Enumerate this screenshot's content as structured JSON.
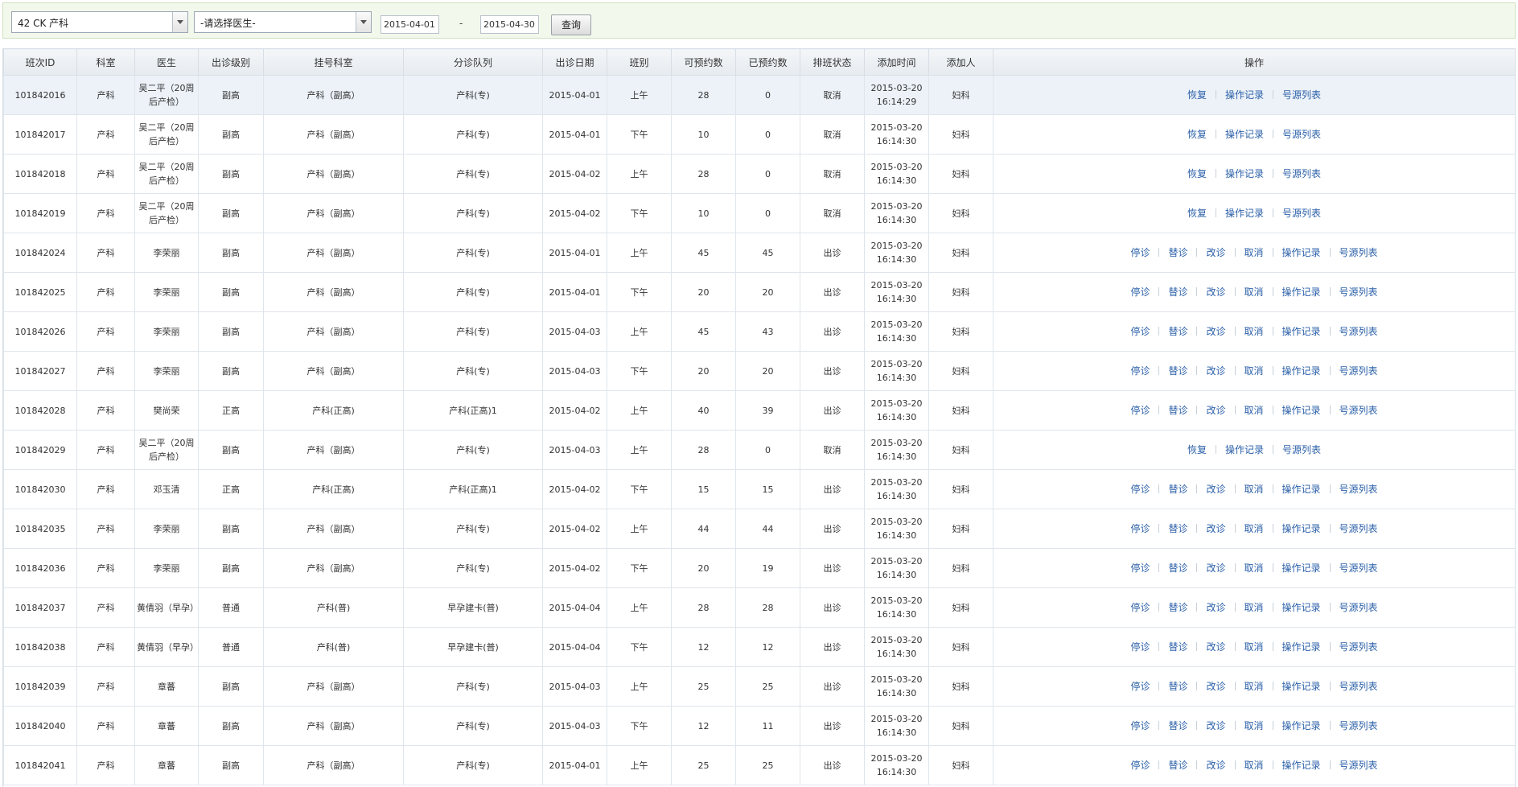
{
  "filters": {
    "department_select": "42 CK 产科",
    "doctor_select": "-请选择医生-",
    "date_from": "2015-04-01",
    "date_separator": "-",
    "date_to": "2015-04-30",
    "query_button": "查询"
  },
  "table": {
    "headers": [
      "班次ID",
      "科室",
      "医生",
      "出诊级别",
      "挂号科室",
      "分诊队列",
      "出诊日期",
      "班别",
      "可预约数",
      "已预约数",
      "排班状态",
      "添加时间",
      "添加人",
      "操作"
    ],
    "action_labels": {
      "stop": "停诊",
      "substitute": "替诊",
      "change": "改诊",
      "cancel": "取消",
      "restore": "恢复",
      "log": "操作记录",
      "source_list": "号源列表"
    },
    "rows": [
      {
        "id": "101842016",
        "dept": "产科",
        "doctor": "吴二平（20周后产检）",
        "level": "副高",
        "reg_dept": "产科（副高）",
        "queue": "产科(专)",
        "date": "2015-04-01",
        "shift": "上午",
        "available": "28",
        "booked": "0",
        "status": "取消",
        "added_date": "2015-03-20",
        "added_time": "16:14:29",
        "added_by": "妇科",
        "actions": [
          "restore",
          "log",
          "source_list"
        ]
      },
      {
        "id": "101842017",
        "dept": "产科",
        "doctor": "吴二平（20周后产检）",
        "level": "副高",
        "reg_dept": "产科（副高）",
        "queue": "产科(专)",
        "date": "2015-04-01",
        "shift": "下午",
        "available": "10",
        "booked": "0",
        "status": "取消",
        "added_date": "2015-03-20",
        "added_time": "16:14:30",
        "added_by": "妇科",
        "actions": [
          "restore",
          "log",
          "source_list"
        ]
      },
      {
        "id": "101842018",
        "dept": "产科",
        "doctor": "吴二平（20周后产检）",
        "level": "副高",
        "reg_dept": "产科（副高）",
        "queue": "产科(专)",
        "date": "2015-04-02",
        "shift": "上午",
        "available": "28",
        "booked": "0",
        "status": "取消",
        "added_date": "2015-03-20",
        "added_time": "16:14:30",
        "added_by": "妇科",
        "actions": [
          "restore",
          "log",
          "source_list"
        ]
      },
      {
        "id": "101842019",
        "dept": "产科",
        "doctor": "吴二平（20周后产检）",
        "level": "副高",
        "reg_dept": "产科（副高）",
        "queue": "产科(专)",
        "date": "2015-04-02",
        "shift": "下午",
        "available": "10",
        "booked": "0",
        "status": "取消",
        "added_date": "2015-03-20",
        "added_time": "16:14:30",
        "added_by": "妇科",
        "actions": [
          "restore",
          "log",
          "source_list"
        ]
      },
      {
        "id": "101842024",
        "dept": "产科",
        "doctor": "李荣丽",
        "level": "副高",
        "reg_dept": "产科（副高）",
        "queue": "产科(专)",
        "date": "2015-04-01",
        "shift": "上午",
        "available": "45",
        "booked": "45",
        "status": "出诊",
        "added_date": "2015-03-20",
        "added_time": "16:14:30",
        "added_by": "妇科",
        "actions": [
          "stop",
          "substitute",
          "change",
          "cancel",
          "log",
          "source_list"
        ]
      },
      {
        "id": "101842025",
        "dept": "产科",
        "doctor": "李荣丽",
        "level": "副高",
        "reg_dept": "产科（副高）",
        "queue": "产科(专)",
        "date": "2015-04-01",
        "shift": "下午",
        "available": "20",
        "booked": "20",
        "status": "出诊",
        "added_date": "2015-03-20",
        "added_time": "16:14:30",
        "added_by": "妇科",
        "actions": [
          "stop",
          "substitute",
          "change",
          "cancel",
          "log",
          "source_list"
        ]
      },
      {
        "id": "101842026",
        "dept": "产科",
        "doctor": "李荣丽",
        "level": "副高",
        "reg_dept": "产科（副高）",
        "queue": "产科(专)",
        "date": "2015-04-03",
        "shift": "上午",
        "available": "45",
        "booked": "43",
        "status": "出诊",
        "added_date": "2015-03-20",
        "added_time": "16:14:30",
        "added_by": "妇科",
        "actions": [
          "stop",
          "substitute",
          "change",
          "cancel",
          "log",
          "source_list"
        ]
      },
      {
        "id": "101842027",
        "dept": "产科",
        "doctor": "李荣丽",
        "level": "副高",
        "reg_dept": "产科（副高）",
        "queue": "产科(专)",
        "date": "2015-04-03",
        "shift": "下午",
        "available": "20",
        "booked": "20",
        "status": "出诊",
        "added_date": "2015-03-20",
        "added_time": "16:14:30",
        "added_by": "妇科",
        "actions": [
          "stop",
          "substitute",
          "change",
          "cancel",
          "log",
          "source_list"
        ]
      },
      {
        "id": "101842028",
        "dept": "产科",
        "doctor": "樊尚荣",
        "level": "正高",
        "reg_dept": "产科(正高)",
        "queue": "产科(正高)1",
        "date": "2015-04-02",
        "shift": "上午",
        "available": "40",
        "booked": "39",
        "status": "出诊",
        "added_date": "2015-03-20",
        "added_time": "16:14:30",
        "added_by": "妇科",
        "actions": [
          "stop",
          "substitute",
          "change",
          "cancel",
          "log",
          "source_list"
        ]
      },
      {
        "id": "101842029",
        "dept": "产科",
        "doctor": "吴二平（20周后产检）",
        "level": "副高",
        "reg_dept": "产科（副高）",
        "queue": "产科(专)",
        "date": "2015-04-03",
        "shift": "上午",
        "available": "28",
        "booked": "0",
        "status": "取消",
        "added_date": "2015-03-20",
        "added_time": "16:14:30",
        "added_by": "妇科",
        "actions": [
          "restore",
          "log",
          "source_list"
        ]
      },
      {
        "id": "101842030",
        "dept": "产科",
        "doctor": "邓玉清",
        "level": "正高",
        "reg_dept": "产科(正高)",
        "queue": "产科(正高)1",
        "date": "2015-04-02",
        "shift": "下午",
        "available": "15",
        "booked": "15",
        "status": "出诊",
        "added_date": "2015-03-20",
        "added_time": "16:14:30",
        "added_by": "妇科",
        "actions": [
          "stop",
          "substitute",
          "change",
          "cancel",
          "log",
          "source_list"
        ]
      },
      {
        "id": "101842035",
        "dept": "产科",
        "doctor": "李荣丽",
        "level": "副高",
        "reg_dept": "产科（副高）",
        "queue": "产科(专)",
        "date": "2015-04-02",
        "shift": "上午",
        "available": "44",
        "booked": "44",
        "status": "出诊",
        "added_date": "2015-03-20",
        "added_time": "16:14:30",
        "added_by": "妇科",
        "actions": [
          "stop",
          "substitute",
          "change",
          "cancel",
          "log",
          "source_list"
        ]
      },
      {
        "id": "101842036",
        "dept": "产科",
        "doctor": "李荣丽",
        "level": "副高",
        "reg_dept": "产科（副高）",
        "queue": "产科(专)",
        "date": "2015-04-02",
        "shift": "下午",
        "available": "20",
        "booked": "19",
        "status": "出诊",
        "added_date": "2015-03-20",
        "added_time": "16:14:30",
        "added_by": "妇科",
        "actions": [
          "stop",
          "substitute",
          "change",
          "cancel",
          "log",
          "source_list"
        ]
      },
      {
        "id": "101842037",
        "dept": "产科",
        "doctor": "黄倩羽（早孕）",
        "level": "普通",
        "reg_dept": "产科(普)",
        "queue": "早孕建卡(普)",
        "date": "2015-04-04",
        "shift": "上午",
        "available": "28",
        "booked": "28",
        "status": "出诊",
        "added_date": "2015-03-20",
        "added_time": "16:14:30",
        "added_by": "妇科",
        "actions": [
          "stop",
          "substitute",
          "change",
          "cancel",
          "log",
          "source_list"
        ]
      },
      {
        "id": "101842038",
        "dept": "产科",
        "doctor": "黄倩羽（早孕）",
        "level": "普通",
        "reg_dept": "产科(普)",
        "queue": "早孕建卡(普)",
        "date": "2015-04-04",
        "shift": "下午",
        "available": "12",
        "booked": "12",
        "status": "出诊",
        "added_date": "2015-03-20",
        "added_time": "16:14:30",
        "added_by": "妇科",
        "actions": [
          "stop",
          "substitute",
          "change",
          "cancel",
          "log",
          "source_list"
        ]
      },
      {
        "id": "101842039",
        "dept": "产科",
        "doctor": "章蕃",
        "level": "副高",
        "reg_dept": "产科（副高）",
        "queue": "产科(专)",
        "date": "2015-04-03",
        "shift": "上午",
        "available": "25",
        "booked": "25",
        "status": "出诊",
        "added_date": "2015-03-20",
        "added_time": "16:14:30",
        "added_by": "妇科",
        "actions": [
          "stop",
          "substitute",
          "change",
          "cancel",
          "log",
          "source_list"
        ]
      },
      {
        "id": "101842040",
        "dept": "产科",
        "doctor": "章蕃",
        "level": "副高",
        "reg_dept": "产科（副高）",
        "queue": "产科(专)",
        "date": "2015-04-03",
        "shift": "下午",
        "available": "12",
        "booked": "11",
        "status": "出诊",
        "added_date": "2015-03-20",
        "added_time": "16:14:30",
        "added_by": "妇科",
        "actions": [
          "stop",
          "substitute",
          "change",
          "cancel",
          "log",
          "source_list"
        ]
      },
      {
        "id": "101842041",
        "dept": "产科",
        "doctor": "章蕃",
        "level": "副高",
        "reg_dept": "产科（副高）",
        "queue": "产科(专)",
        "date": "2015-04-01",
        "shift": "上午",
        "available": "25",
        "booked": "25",
        "status": "出诊",
        "added_date": "2015-03-20",
        "added_time": "16:14:30",
        "added_by": "妇科",
        "actions": [
          "stop",
          "substitute",
          "change",
          "cancel",
          "log",
          "source_list"
        ]
      }
    ]
  }
}
